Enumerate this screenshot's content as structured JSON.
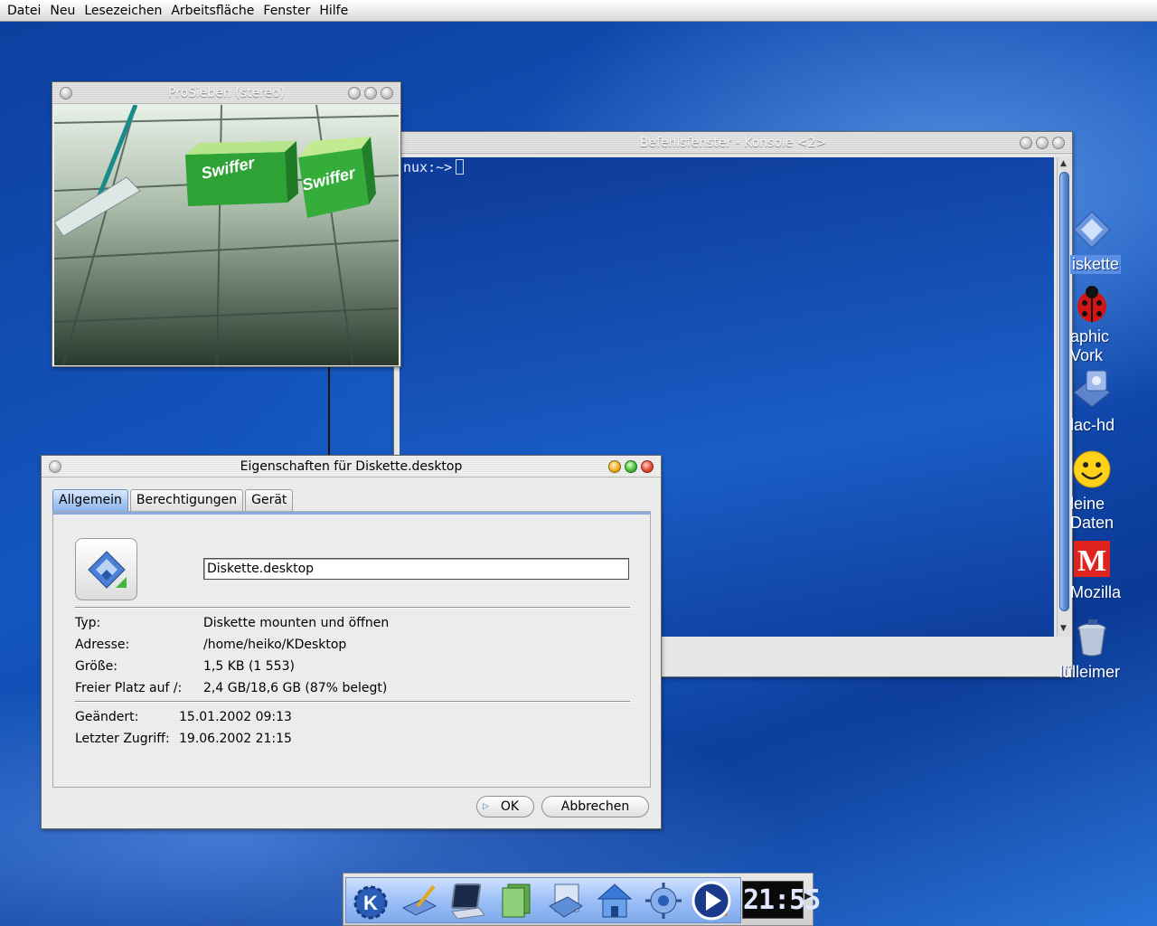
{
  "menubar": {
    "items": [
      "Datei",
      "Neu",
      "Lesezeichen",
      "Arbeitsfläche",
      "Fenster",
      "Hilfe"
    ]
  },
  "konsole": {
    "title": "Befehlsfenster - Konsole <2>",
    "prompt": "nux:~>"
  },
  "tv": {
    "title": "ProSieben (stereo)",
    "box_brand": "Swiffer"
  },
  "properties": {
    "title": "Eigenschaften für Diskette.desktop",
    "tabs": [
      {
        "label": "Allgemein",
        "active": true
      },
      {
        "label": "Berechtigungen",
        "active": false
      },
      {
        "label": "Gerät",
        "active": false
      }
    ],
    "name_value": "Diskette.desktop",
    "info": [
      {
        "label": "Typ:",
        "value": "Diskette mounten und öffnen"
      },
      {
        "label": "Adresse:",
        "value": "/home/heiko/KDesktop"
      },
      {
        "label": "Größe:",
        "value": "1,5 KB (1 553)"
      },
      {
        "label": "Freier Platz auf /:",
        "value": "2,4 GB/18,6 GB (87% belegt)"
      }
    ],
    "dates": [
      {
        "label": "Geändert:",
        "value": "15.01.2002 09:13"
      },
      {
        "label": "Letzter Zugriff:",
        "value": "19.06.2002 21:15"
      }
    ],
    "ok_label": "OK",
    "cancel_label": "Abbrechen"
  },
  "desktop_icons": [
    {
      "label_lines": [
        "iskette"
      ],
      "selected": true,
      "icon": "floppy-icon"
    },
    {
      "label_lines": [
        "aphic",
        "Vork"
      ],
      "selected": false,
      "icon": "ladybug-icon"
    },
    {
      "label_lines": [
        "lac-hd"
      ],
      "selected": false,
      "icon": "mac-hd-icon"
    },
    {
      "label_lines": [
        "leine",
        "Daten"
      ],
      "selected": false,
      "icon": "smiley-icon"
    },
    {
      "label_lines": [
        "Mozilla"
      ],
      "selected": false,
      "icon": "mozilla-icon"
    },
    {
      "label_lines": [
        "lülleimer"
      ],
      "selected": false,
      "icon": "trash-icon"
    }
  ],
  "taskbar": {
    "icons": [
      "kde-menu-icon",
      "desktop-icon",
      "terminal-icon",
      "help-icon",
      "home-icon",
      "konqueror-icon",
      "kmail-icon",
      "media-player-icon"
    ],
    "clock": "21:55"
  },
  "colors": {
    "accent": "#5b8fe6",
    "desktop_blue": "#1457c0"
  }
}
